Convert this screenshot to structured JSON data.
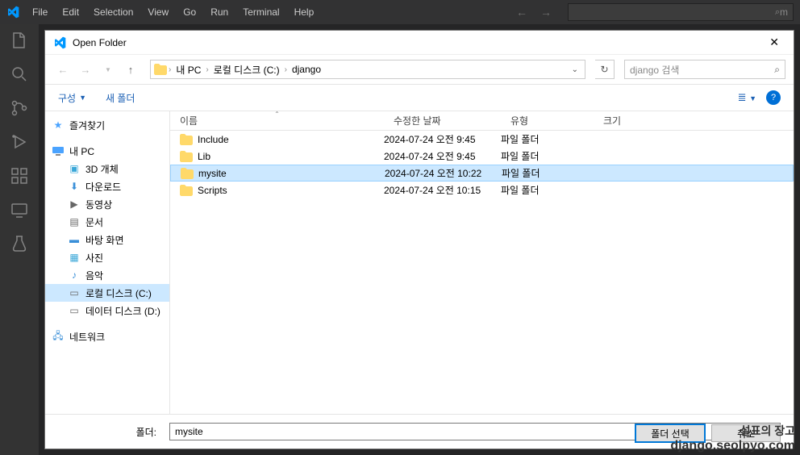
{
  "vscode": {
    "menu": [
      "File",
      "Edit",
      "Selection",
      "View",
      "Go",
      "Run",
      "Terminal",
      "Help"
    ],
    "search_text": "m"
  },
  "dialog": {
    "title": "Open Folder",
    "breadcrumbs": [
      "내 PC",
      "로컬 디스크 (C:)",
      "django"
    ],
    "search_placeholder": "django 검색",
    "toolbar": {
      "organize": "구성",
      "new_folder": "새 폴더"
    },
    "columns": {
      "name": "이름",
      "date": "수정한 날짜",
      "type": "유형",
      "size": "크기"
    },
    "tree": {
      "quick_access": "즐겨찾기",
      "this_pc": "내 PC",
      "children": [
        "3D 개체",
        "다운로드",
        "동영상",
        "문서",
        "바탕 화면",
        "사진",
        "음악",
        "로컬 디스크 (C:)",
        "데이터 디스크 (D:)"
      ],
      "network": "네트워크"
    },
    "files": [
      {
        "name": "Include",
        "date": "2024-07-24 오전 9:45",
        "type": "파일 폴더",
        "selected": false
      },
      {
        "name": "Lib",
        "date": "2024-07-24 오전 9:45",
        "type": "파일 폴더",
        "selected": false
      },
      {
        "name": "mysite",
        "date": "2024-07-24 오전 10:22",
        "type": "파일 폴더",
        "selected": true
      },
      {
        "name": "Scripts",
        "date": "2024-07-24 오전 10:15",
        "type": "파일 폴더",
        "selected": false
      }
    ],
    "footer": {
      "label": "폴더:",
      "value": "mysite",
      "select_button": "폴더 선택",
      "cancel_button": "취소"
    }
  },
  "watermark": {
    "line1": "설표의 장고",
    "line2": "django.seolpyo.com"
  }
}
